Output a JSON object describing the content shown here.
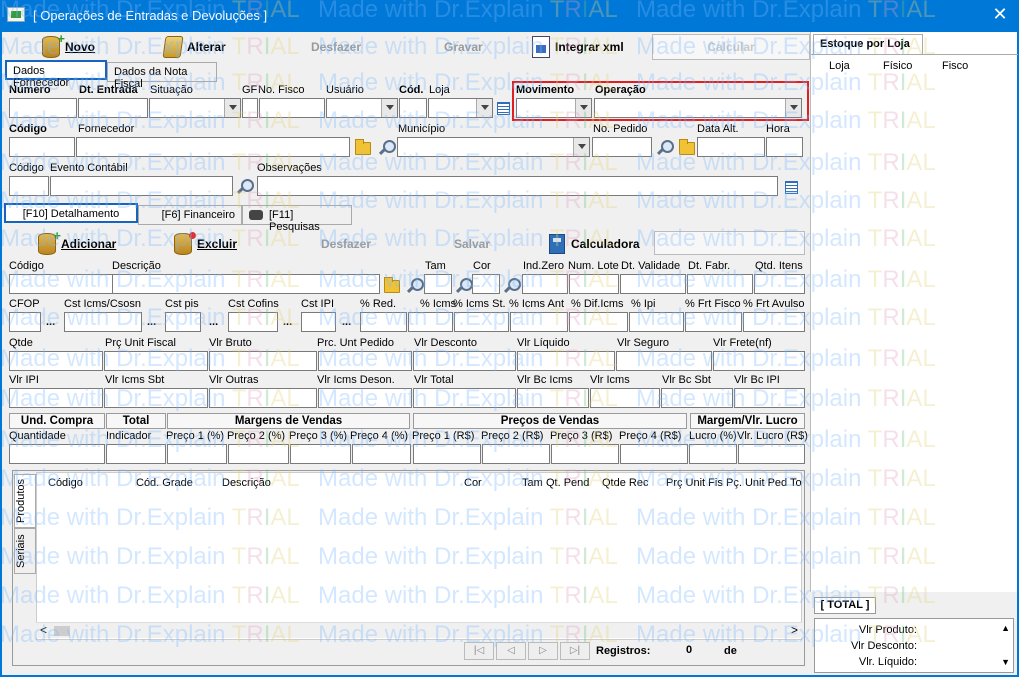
{
  "window": {
    "title": "[ Operações de Entradas e Devoluções ]",
    "close": "✕"
  },
  "toolbar": {
    "novo": "Novo",
    "alterar": "Alterar",
    "desfazer": "Desfazer",
    "gravar": "Gravar",
    "integrar": "Integrar xml",
    "calcular": "Calcular"
  },
  "tabs_top": {
    "fornecedor": "Dados Fornecedor",
    "nota": "Dados da Nota Fiscal"
  },
  "form1": {
    "numero": "Número",
    "dt_entrada": "Dt. Entrada",
    "situacao": "Situação",
    "gf": "GF",
    "no_fisco": "No. Fisco",
    "usuario": "Usuário",
    "cod": "Cód.",
    "loja": "Loja",
    "movimento": "Movimento",
    "operacao": "Operação"
  },
  "form2": {
    "codigo": "Código",
    "fornecedor": "Fornecedor",
    "municipio": "Município",
    "no_pedido": "No. Pedido",
    "data_alt": "Data Alt.",
    "hora": "Hora"
  },
  "form3": {
    "codigo": "Código",
    "evento": "Evento Contábil",
    "obs": "Observações"
  },
  "tabs_mid": {
    "detalhamento": "[F10] Detalhamento",
    "financeiro": "[F6] Financeiro",
    "pesquisas": "[F11] Pesquisas"
  },
  "toolbar2": {
    "adicionar": "Adicionar",
    "excluir": "Excluir",
    "desfazer": "Desfazer",
    "salvar": "Salvar",
    "calculadora": "Calculadora"
  },
  "item1": {
    "codigo": "Código",
    "descricao": "Descrição",
    "tam": "Tam",
    "cor": "Cor",
    "ind_zero": "Ind.Zero",
    "num_lote": "Num. Lote",
    "dt_validade": "Dt. Validade",
    "dt_fabr": "Dt. Fabr.",
    "qtd_itens": "Qtd. Itens"
  },
  "item2": {
    "cfop": "CFOP",
    "cst_icms": "Cst Icms/Csosn",
    "cst_pis": "Cst pis",
    "cst_cofins": "Cst Cofins",
    "cst_ipi": "Cst IPI",
    "red": "% Red.",
    "icms": "% Icms",
    "icms_st": "% Icms St.",
    "icms_ant": "% Icms Ant",
    "dif_icms": "% Dif.Icms",
    "ipi": "% Ipi",
    "frt_fisco": "% Frt Fisco",
    "frt_avulso": "% Frt Avulso",
    "dots": "..."
  },
  "item3": {
    "qtde": "Qtde",
    "prc_unit_fiscal": "Prç Unit Fiscal",
    "vlr_bruto": "Vlr Bruto",
    "prc_unt_pedido": "Prc. Unt Pedido",
    "vlr_desconto": "Vlr Desconto",
    "vlr_liquido": "Vlr Líquido",
    "vlr_seguro": "Vlr Seguro",
    "vlr_frete": "Vlr Frete(nf)"
  },
  "item4": {
    "vlr_ipi": "Vlr IPI",
    "vlr_icms_sbt": "Vlr Icms Sbt",
    "vlr_outras": "Vlr Outras",
    "vlr_icms_deson": "Vlr Icms Deson.",
    "vlr_total": "Vlr Total",
    "vlr_bc_icms": "Vlr Bc Icms",
    "vlr_icms": "Vlr Icms",
    "vlr_bc_sbt": "Vlr Bc Sbt",
    "vlr_bc_ipi": "Vlr Bc IPI"
  },
  "sections": {
    "und_compra": "Und. Compra",
    "total": "Total",
    "margens": "Margens de Vendas",
    "precos": "Preços de Vendas",
    "margem_lucro": "Margem/Vlr. Lucro"
  },
  "item5": {
    "quantidade": "Quantidade",
    "indicador": "Indicador",
    "p1": "Preço 1 (%)",
    "p2": "Preço 2 (%)",
    "p3": "Preço 3 (%)",
    "p4": "Preço 4 (%)",
    "r1": "Preço 1 (R$)",
    "r2": "Preço 2 (R$)",
    "r3": "Preço 3 (R$)",
    "r4": "Preço 4 (R$)",
    "lucro_pct": "Lucro (%)",
    "lucro_vlr": "Vlr. Lucro (R$)"
  },
  "grid": {
    "columns": [
      "Código",
      "Cód. Grade",
      "Descrição",
      "Cor",
      "Tam",
      "Qt. Pend",
      "Qtde Rec",
      "Prç Unit Fis",
      "Pç. Unit Ped",
      "To"
    ],
    "tab_produtos": "Produtos",
    "tab_seriais": "Seriais",
    "registros": "Registros:",
    "registros_count": "0",
    "de": "de",
    "nav": [
      "|◁",
      "◁",
      "▷",
      "▷|"
    ],
    "scroll_left": "<",
    "scroll_right": ">"
  },
  "stock": {
    "title": "Estoque por Loja",
    "cols": [
      "Loja",
      "Físico",
      "Fisco"
    ]
  },
  "totals": {
    "title": "[ TOTAL ]",
    "vlr_produto": "Vlr Produto:",
    "vlr_desconto": "Vlr Desconto:",
    "vlr_liquido": "Vlr. Líquido:",
    "up": "▲",
    "down": "▼"
  },
  "watermark": {
    "made": "Made",
    "with": "with",
    "dr": "Dr.Explain",
    "t": "T",
    "r": "R",
    "i": "I",
    "al": "AL"
  }
}
